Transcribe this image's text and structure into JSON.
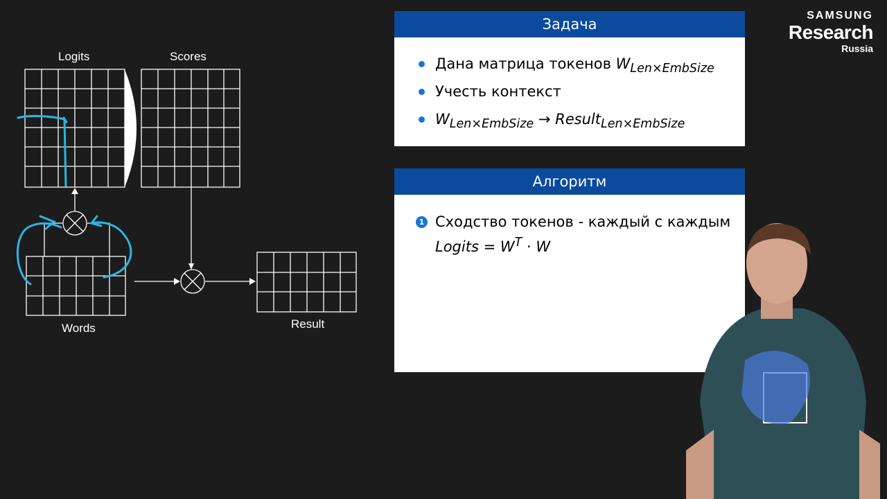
{
  "diagram": {
    "labels": {
      "logits": "Logits",
      "scores": "Scores",
      "words": "Words",
      "result": "Result"
    }
  },
  "task_block": {
    "title": "Задача",
    "items": [
      {
        "text": "Дана матрица токенов ",
        "math": "W",
        "sub": "Len×EmbSize"
      },
      {
        "text": "Учесть контекст"
      },
      {
        "math_a": "W",
        "sub_a": "Len×EmbSize",
        "arrow": " → ",
        "math_b": "Result",
        "sub_b": "Len×EmbSize"
      }
    ]
  },
  "algorithm_block": {
    "title": "Алгоритм",
    "steps": [
      {
        "number": "1",
        "text": "Сходство токенов - каждый с каждым",
        "formula_lhs": "Logits",
        "formula_eq": " = ",
        "formula_w": "W",
        "formula_sup": "T",
        "formula_dot": " · ",
        "formula_w2": "W"
      }
    ]
  },
  "logo": {
    "line1": "SAMSUNG",
    "line2": "Research",
    "line3": "Russia"
  },
  "colors": {
    "background": "#1c1c1c",
    "block_header": "#0b4a9c",
    "bullet": "#1a73d9",
    "annotation": "#29b6e8"
  }
}
